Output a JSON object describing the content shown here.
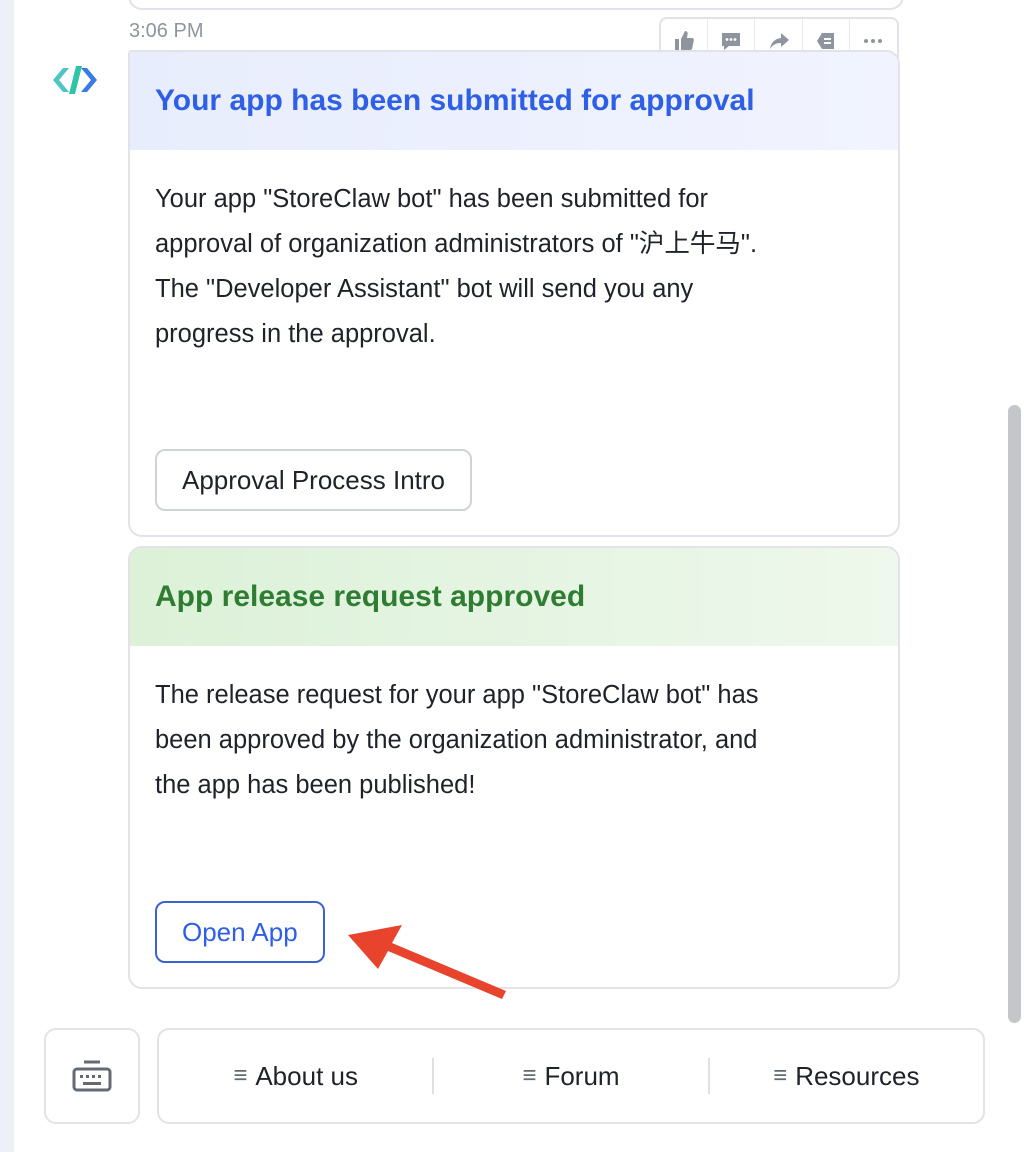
{
  "chat": {
    "timestamp": "3:06 PM",
    "toolbar_icons": [
      "thumbs-up-icon",
      "reply-comment-icon",
      "forward-icon",
      "pin-icon",
      "more-icon"
    ]
  },
  "card_submitted": {
    "header_color": "#2e5fe6",
    "title": "Your app has been submitted for approval",
    "body": "Your app \"StoreClaw bot\" has been submitted for\napproval of organization administrators of \"沪上牛马\".\nThe \"Developer Assistant\" bot will send you any\nprogress in the approval.",
    "button_label": "Approval Process Intro"
  },
  "card_approved": {
    "header_color": "#2e7d32",
    "title": "App release request approved",
    "body": "The release request for your app \"StoreClaw bot\" has\nbeen approved by the organization administrator, and\nthe app has been published!",
    "button_label": "Open App"
  },
  "annotation": {
    "arrow_color": "#e8432d"
  },
  "bottom_menu": {
    "keyboard_icon": "keyboard-icon",
    "items": [
      {
        "icon": "≡",
        "label": "About us"
      },
      {
        "icon": "≡",
        "label": "Forum"
      },
      {
        "icon": "≡",
        "label": "Resources"
      }
    ]
  }
}
